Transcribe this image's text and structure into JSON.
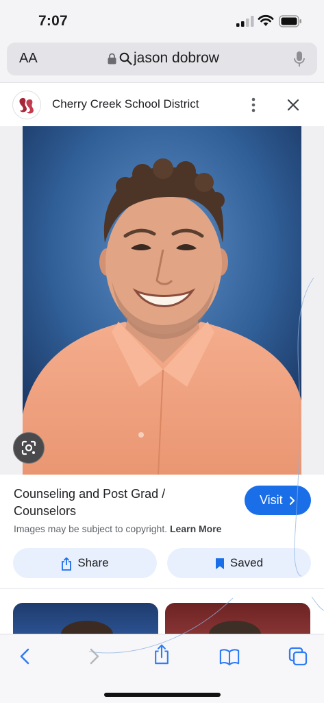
{
  "status_bar": {
    "time": "7:07"
  },
  "address_bar": {
    "text_size_label": "AA",
    "query": "jason dobrow"
  },
  "result": {
    "site_name": "Cherry Creek School District",
    "title": "Counseling and Post Grad / Counselors",
    "visit_label": "Visit",
    "copyright_text": "Images may be subject to copyright.",
    "learn_more_label": "Learn More",
    "share_label": "Share",
    "saved_label": "Saved"
  },
  "colors": {
    "accent": "#1a6ee8",
    "pill_background": "#e8f0fe",
    "toolbar_icon": "#2f7cf6",
    "photo_background": "#2b5b90",
    "shirt": "#f2a582"
  },
  "icons": {
    "status": [
      "signal-icon",
      "wifi-icon",
      "battery-icon"
    ],
    "address_bar": [
      "lock-icon",
      "search-icon",
      "microphone-icon"
    ],
    "header": [
      "more-options-icon",
      "close-icon"
    ],
    "toolbar": [
      "back-icon",
      "forward-icon",
      "share-icon",
      "bookmarks-icon",
      "tabs-icon"
    ]
  }
}
